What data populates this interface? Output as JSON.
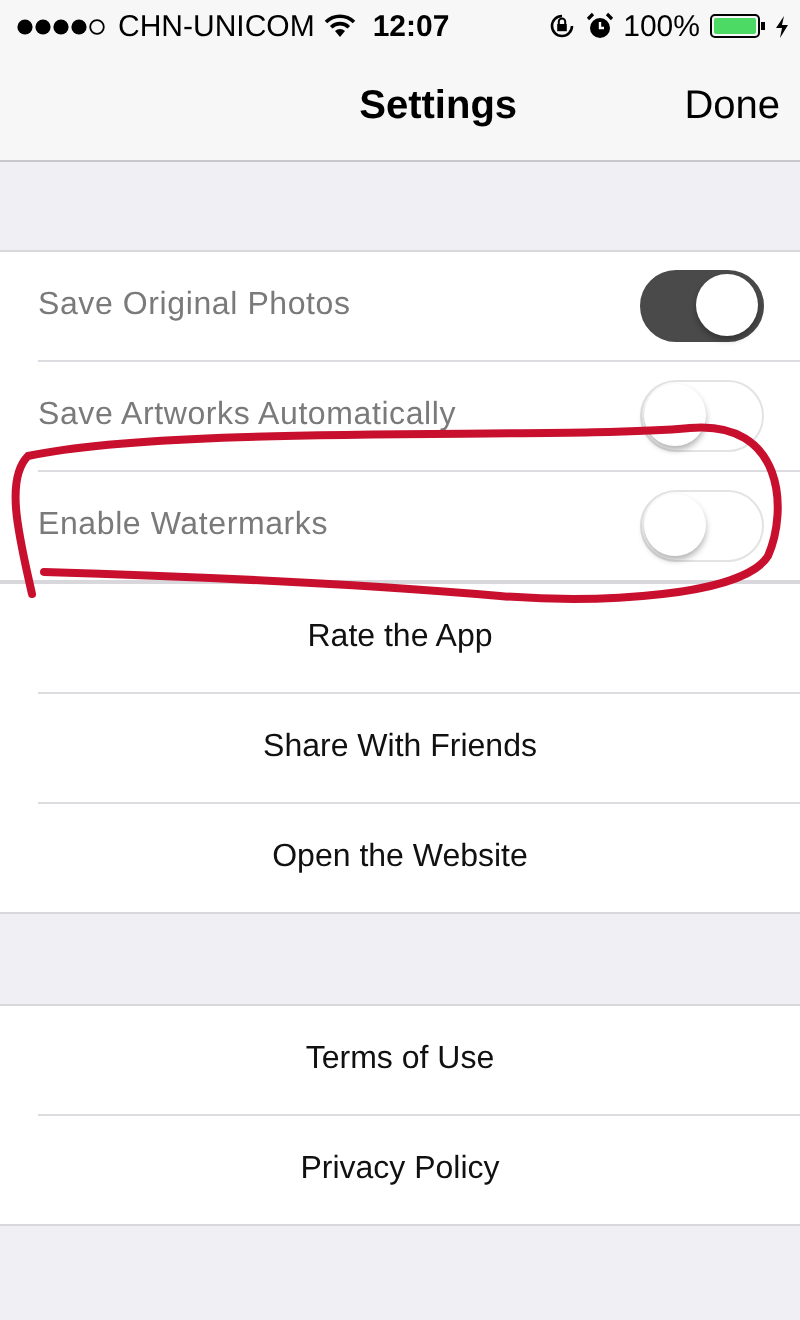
{
  "status_bar": {
    "carrier": "CHN-UNICOM",
    "time": "12:07",
    "battery": "100%"
  },
  "nav": {
    "title": "Settings",
    "action": "Done"
  },
  "toggles": [
    {
      "label": "Save Original Photos",
      "on": true
    },
    {
      "label": "Save Artworks Automatically",
      "on": false
    },
    {
      "label": "Enable Watermarks",
      "on": false
    }
  ],
  "link_groups": [
    [
      "Rate the App",
      "Share With Friends",
      "Open the Website"
    ],
    [
      "Terms of Use",
      "Privacy Policy"
    ]
  ]
}
